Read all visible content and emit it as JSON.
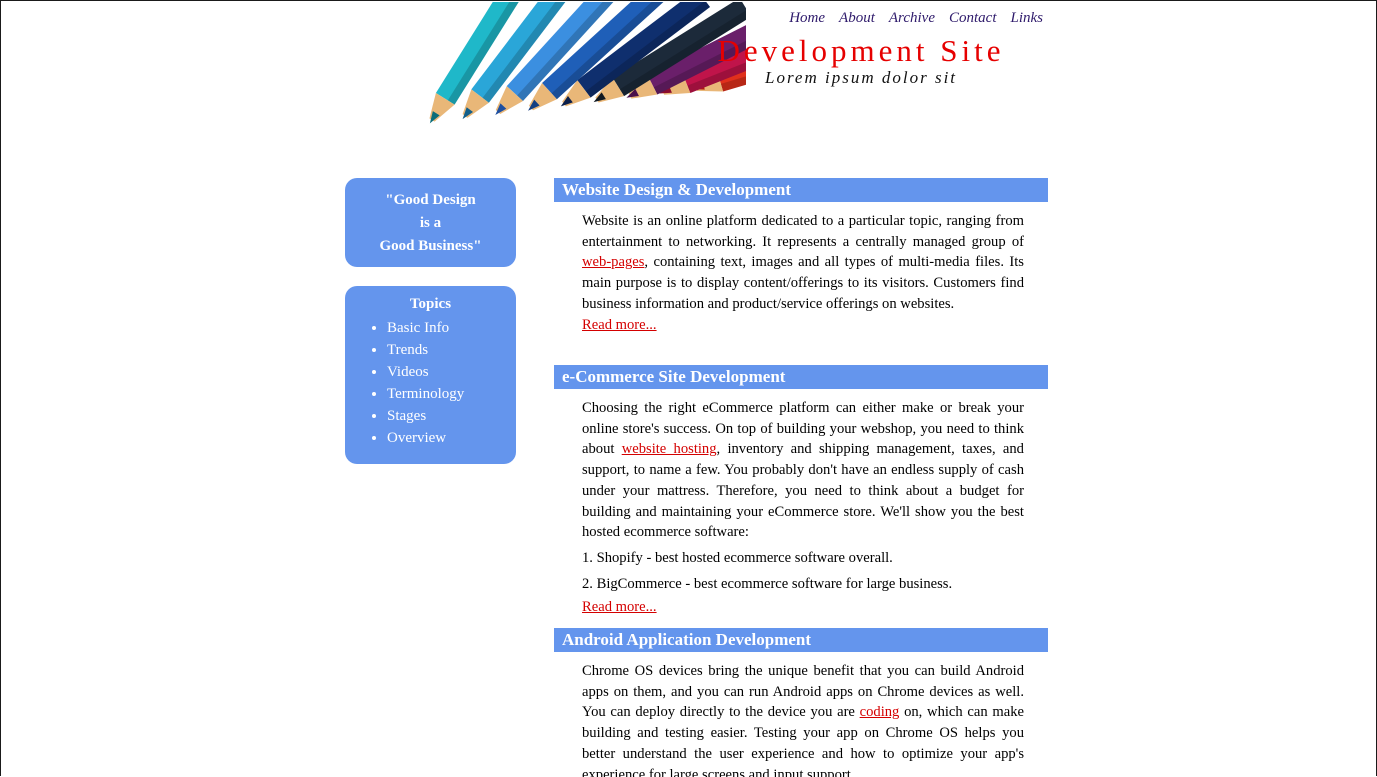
{
  "header": {
    "nav": [
      "Home",
      "About",
      "Archive",
      "Contact",
      "Links"
    ],
    "title": "Development Site",
    "tagline": "Lorem ipsum dolor sit"
  },
  "sidebar": {
    "quote_lines": [
      "\"Good Design",
      "is a",
      "Good Business\""
    ],
    "topics_title": "Topics",
    "topics": [
      "Basic Info",
      "Trends",
      "Videos",
      "Terminology",
      "Stages",
      "Overview"
    ]
  },
  "sections": [
    {
      "title": "Website Design & Development",
      "text_before": "Website is an online platform dedicated to a particular topic, ranging from entertainment to networking. It represents a centrally managed group of ",
      "link": "web-pages",
      "text_after": ", containing text, images and all types of multi-media files. Its main purpose is to display content/offerings to its visitors. Customers find business information and product/service offerings on websites.",
      "read_more": "Read more..."
    },
    {
      "title": "e-Commerce Site Development",
      "text_before": "Choosing the right eCommerce platform can either make or break your online store's success. On top of building your webshop, you need to think about ",
      "link": "website hosting",
      "text_after": ", inventory and shipping management, taxes, and support, to name a few. You probably don't have an endless supply of cash under your mattress. Therefore, you need to think about a budget for building and maintaining your eCommerce store. We'll show you the best hosted ecommerce software:",
      "list": [
        "1. Shopify - best hosted ecommerce software overall.",
        "2. BigCommerce - best ecommerce software for large business."
      ],
      "read_more": "Read more..."
    },
    {
      "title": "Android Application Development",
      "text_before": "Chrome OS devices bring the unique benefit that you can build Android apps on them, and you can run Android apps on Chrome devices as well. You can deploy directly to the device you are ",
      "link": "coding",
      "text_after": " on, which can make building and testing easier. Testing your app on Chrome OS helps you better understand the user experience and how to optimize your app's experience for large screens and input support."
    }
  ],
  "colors": {
    "accent": "#6495ed",
    "title": "#e60000",
    "link": "#d40000",
    "nav": "#2e1a6b"
  },
  "images": {
    "header": "colored-pencils-image"
  }
}
